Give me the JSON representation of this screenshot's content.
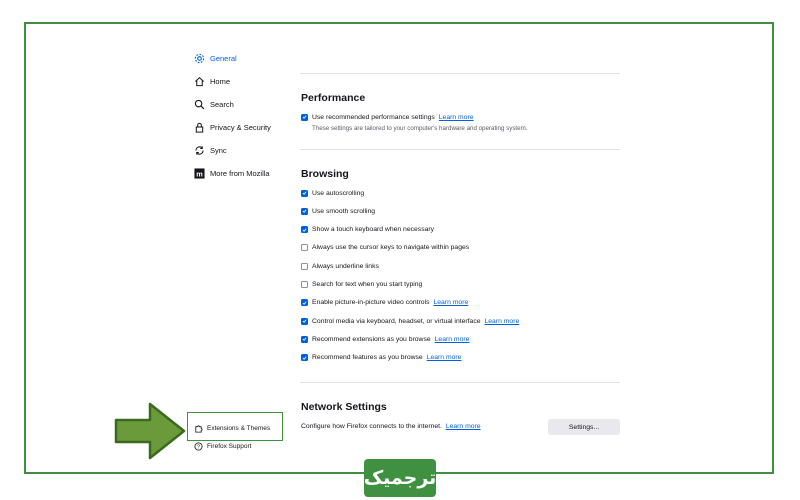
{
  "sidebar": {
    "items": [
      {
        "label": "General",
        "icon": "gear-icon",
        "active": true
      },
      {
        "label": "Home",
        "icon": "home-icon"
      },
      {
        "label": "Search",
        "icon": "search-icon"
      },
      {
        "label": "Privacy & Security",
        "icon": "lock-icon"
      },
      {
        "label": "Sync",
        "icon": "sync-icon"
      },
      {
        "label": "More from Mozilla",
        "icon": "mozilla-icon"
      }
    ],
    "footer": [
      {
        "label": "Extensions & Themes",
        "icon": "puzzle-icon"
      },
      {
        "label": "Firefox Support",
        "icon": "help-icon"
      }
    ]
  },
  "performance": {
    "title": "Performance",
    "recommended_label": "Use recommended performance settings",
    "learn_more": "Learn more",
    "description": "These settings are tailored to your computer's hardware and operating system."
  },
  "browsing": {
    "title": "Browsing",
    "options": [
      {
        "label": "Use autoscrolling",
        "checked": true,
        "link": ""
      },
      {
        "label": "Use smooth scrolling",
        "checked": true,
        "link": ""
      },
      {
        "label": "Show a touch keyboard when necessary",
        "checked": true,
        "link": ""
      },
      {
        "label": "Always use the cursor keys to navigate within pages",
        "checked": false,
        "link": ""
      },
      {
        "label": "Always underline links",
        "checked": false,
        "link": ""
      },
      {
        "label": "Search for text when you start typing",
        "checked": false,
        "link": ""
      },
      {
        "label": "Enable picture-in-picture video controls",
        "checked": true,
        "link": "Learn more"
      },
      {
        "label": "Control media via keyboard, headset, or virtual interface",
        "checked": true,
        "link": "Learn more"
      },
      {
        "label": "Recommend extensions as you browse",
        "checked": true,
        "link": "Learn more"
      },
      {
        "label": "Recommend features as you browse",
        "checked": true,
        "link": "Learn more"
      }
    ]
  },
  "network": {
    "title": "Network Settings",
    "description": "Configure how Firefox connects to the internet.",
    "learn_more": "Learn more",
    "button": "Settings..."
  },
  "watermark": {
    "text": "ترجمیک"
  },
  "colors": {
    "accent": "#0061e0",
    "highlight": "#3f9141"
  }
}
